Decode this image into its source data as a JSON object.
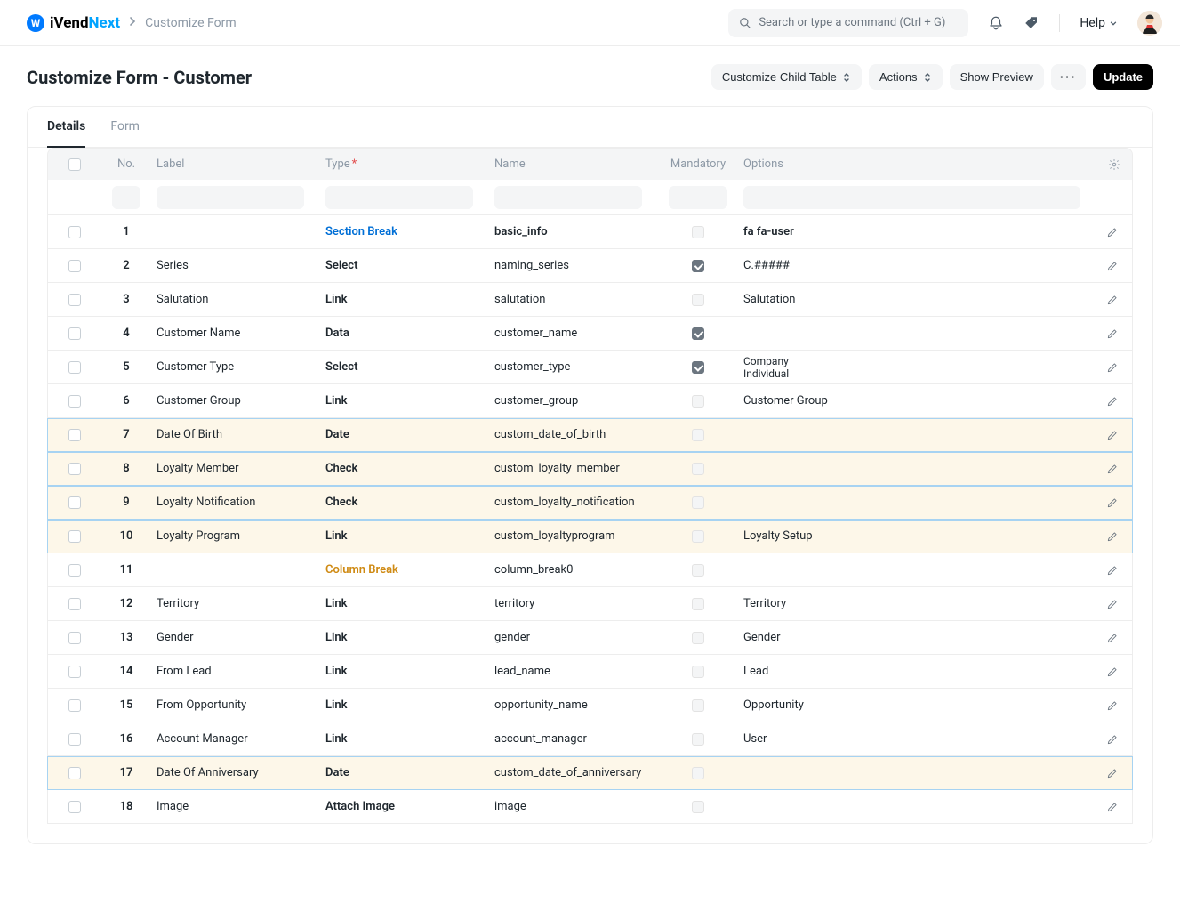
{
  "topbar": {
    "logo_dark": "iVend",
    "logo_accent": "Next",
    "breadcrumb": "Customize Form",
    "search_placeholder": "Search or type a command (Ctrl + G)",
    "help": "Help"
  },
  "header": {
    "title": "Customize Form - Customer",
    "btn_child": "Customize Child Table",
    "btn_actions": "Actions",
    "btn_preview": "Show Preview",
    "btn_update": "Update"
  },
  "tabs": {
    "details": "Details",
    "form": "Form"
  },
  "columns": {
    "no": "No.",
    "label": "Label",
    "type": "Type",
    "name": "Name",
    "mandatory": "Mandatory",
    "options": "Options"
  },
  "rows": [
    {
      "no": "1",
      "label": "",
      "type": "Section Break",
      "type_class": "t-section",
      "name": "basic_info",
      "name_bold": true,
      "mand": "none",
      "opt": "fa fa-user",
      "opt_bold": true,
      "hl": false
    },
    {
      "no": "2",
      "label": "Series",
      "type": "Select",
      "type_class": "",
      "name": "naming_series",
      "name_bold": false,
      "mand": "on",
      "opt": "C.#####",
      "opt_bold": false,
      "hl": false
    },
    {
      "no": "3",
      "label": "Salutation",
      "type": "Link",
      "type_class": "",
      "name": "salutation",
      "name_bold": false,
      "mand": "off",
      "opt": "Salutation",
      "opt_bold": false,
      "hl": false
    },
    {
      "no": "4",
      "label": "Customer Name",
      "type": "Data",
      "type_class": "",
      "name": "customer_name",
      "name_bold": false,
      "mand": "on",
      "opt": "",
      "opt_bold": false,
      "hl": false
    },
    {
      "no": "5",
      "label": "Customer Type",
      "type": "Select",
      "type_class": "",
      "name": "customer_type",
      "name_bold": false,
      "mand": "on",
      "opt": "Company\nIndividual",
      "opt_bold": false,
      "hl": false,
      "multi": true
    },
    {
      "no": "6",
      "label": "Customer Group",
      "type": "Link",
      "type_class": "",
      "name": "customer_group",
      "name_bold": false,
      "mand": "off",
      "opt": "Customer Group",
      "opt_bold": false,
      "hl": false
    },
    {
      "no": "7",
      "label": "Date Of Birth",
      "type": "Date",
      "type_class": "",
      "name": "custom_date_of_birth",
      "name_bold": false,
      "mand": "off",
      "opt": "",
      "opt_bold": false,
      "hl": true
    },
    {
      "no": "8",
      "label": "Loyalty Member",
      "type": "Check",
      "type_class": "",
      "name": "custom_loyalty_member",
      "name_bold": false,
      "mand": "off",
      "opt": "",
      "opt_bold": false,
      "hl": true
    },
    {
      "no": "9",
      "label": "Loyalty Notification",
      "type": "Check",
      "type_class": "",
      "name": "custom_loyalty_notification",
      "name_bold": false,
      "mand": "off",
      "opt": "",
      "opt_bold": false,
      "hl": true
    },
    {
      "no": "10",
      "label": "Loyalty Program",
      "type": "Link",
      "type_class": "",
      "name": "custom_loyaltyprogram",
      "name_bold": false,
      "mand": "off",
      "opt": "Loyalty Setup",
      "opt_bold": false,
      "hl": true
    },
    {
      "no": "11",
      "label": "",
      "type": "Column Break",
      "type_class": "t-column",
      "name": "column_break0",
      "name_bold": false,
      "mand": "off",
      "opt": "",
      "opt_bold": false,
      "hl": false
    },
    {
      "no": "12",
      "label": "Territory",
      "type": "Link",
      "type_class": "",
      "name": "territory",
      "name_bold": false,
      "mand": "off",
      "opt": "Territory",
      "opt_bold": false,
      "hl": false
    },
    {
      "no": "13",
      "label": "Gender",
      "type": "Link",
      "type_class": "",
      "name": "gender",
      "name_bold": false,
      "mand": "off",
      "opt": "Gender",
      "opt_bold": false,
      "hl": false
    },
    {
      "no": "14",
      "label": "From Lead",
      "type": "Link",
      "type_class": "",
      "name": "lead_name",
      "name_bold": false,
      "mand": "off",
      "opt": "Lead",
      "opt_bold": false,
      "hl": false
    },
    {
      "no": "15",
      "label": "From Opportunity",
      "type": "Link",
      "type_class": "",
      "name": "opportunity_name",
      "name_bold": false,
      "mand": "off",
      "opt": "Opportunity",
      "opt_bold": false,
      "hl": false
    },
    {
      "no": "16",
      "label": "Account Manager",
      "type": "Link",
      "type_class": "",
      "name": "account_manager",
      "name_bold": false,
      "mand": "off",
      "opt": "User",
      "opt_bold": false,
      "hl": false
    },
    {
      "no": "17",
      "label": "Date Of Anniversary",
      "type": "Date",
      "type_class": "",
      "name": "custom_date_of_anniversary",
      "name_bold": false,
      "mand": "off",
      "opt": "",
      "opt_bold": false,
      "hl": true
    },
    {
      "no": "18",
      "label": "Image",
      "type": "Attach Image",
      "type_class": "",
      "name": "image",
      "name_bold": false,
      "mand": "off",
      "opt": "",
      "opt_bold": false,
      "hl": false
    }
  ]
}
